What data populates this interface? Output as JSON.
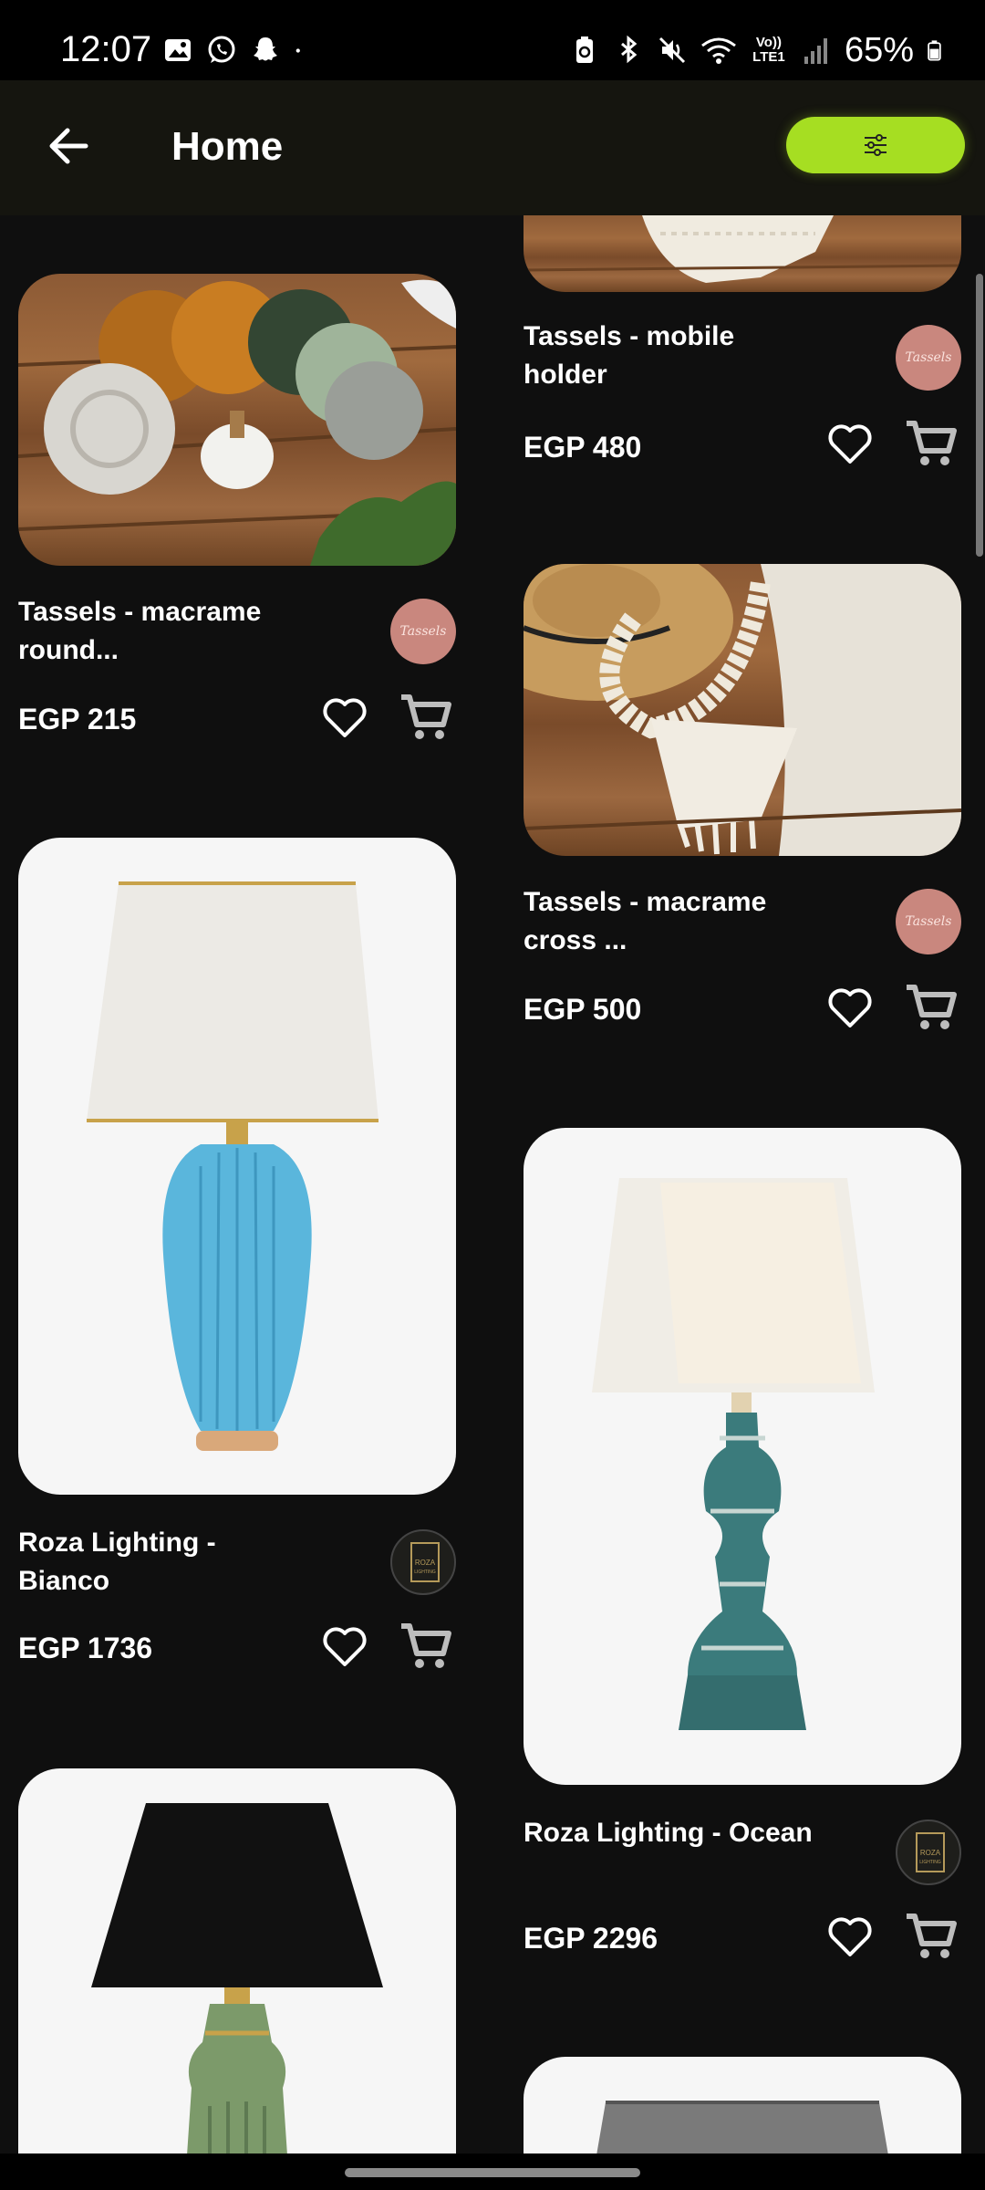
{
  "status_bar": {
    "time": "12:07",
    "battery": "65%",
    "left_icons": [
      "gallery-icon",
      "whatsapp-icon",
      "snapchat-icon",
      "dot-icon"
    ],
    "right_icons": [
      "battery-saver-icon",
      "bluetooth-icon",
      "mute-icon",
      "wifi-icon",
      "volte-icon",
      "signal-icon",
      "battery-icon"
    ],
    "volte_label": "VoLTE1"
  },
  "app_bar": {
    "title": "Home",
    "back_icon": "arrow-left-icon",
    "filter_icon": "sliders-icon",
    "accent": "#a6de22"
  },
  "products": [
    {
      "title": "Tassels - mobile holder",
      "price": "EGP 480",
      "brand": "Tassels"
    },
    {
      "title": "Tassels - macrame round...",
      "price": "EGP 215",
      "brand": "Tassels"
    },
    {
      "title": "Tassels - macrame cross ...",
      "price": "EGP 500",
      "brand": "Tassels"
    },
    {
      "title": "Roza Lighting - Bianco",
      "price": "EGP 1736",
      "brand": "Roza Lighting"
    },
    {
      "title": "Roza Lighting - Ocean",
      "price": "EGP 2296",
      "brand": "Roza Lighting"
    },
    {
      "title": "",
      "price": "",
      "brand": ""
    },
    {
      "title": "",
      "price": "",
      "brand": ""
    }
  ],
  "logos": {
    "tassels": "Tassels",
    "roza_top": "ROZA",
    "roza_bottom": "LIGHTING"
  },
  "icons": {
    "favorite": "heart-outline-icon",
    "cart": "cart-icon"
  }
}
